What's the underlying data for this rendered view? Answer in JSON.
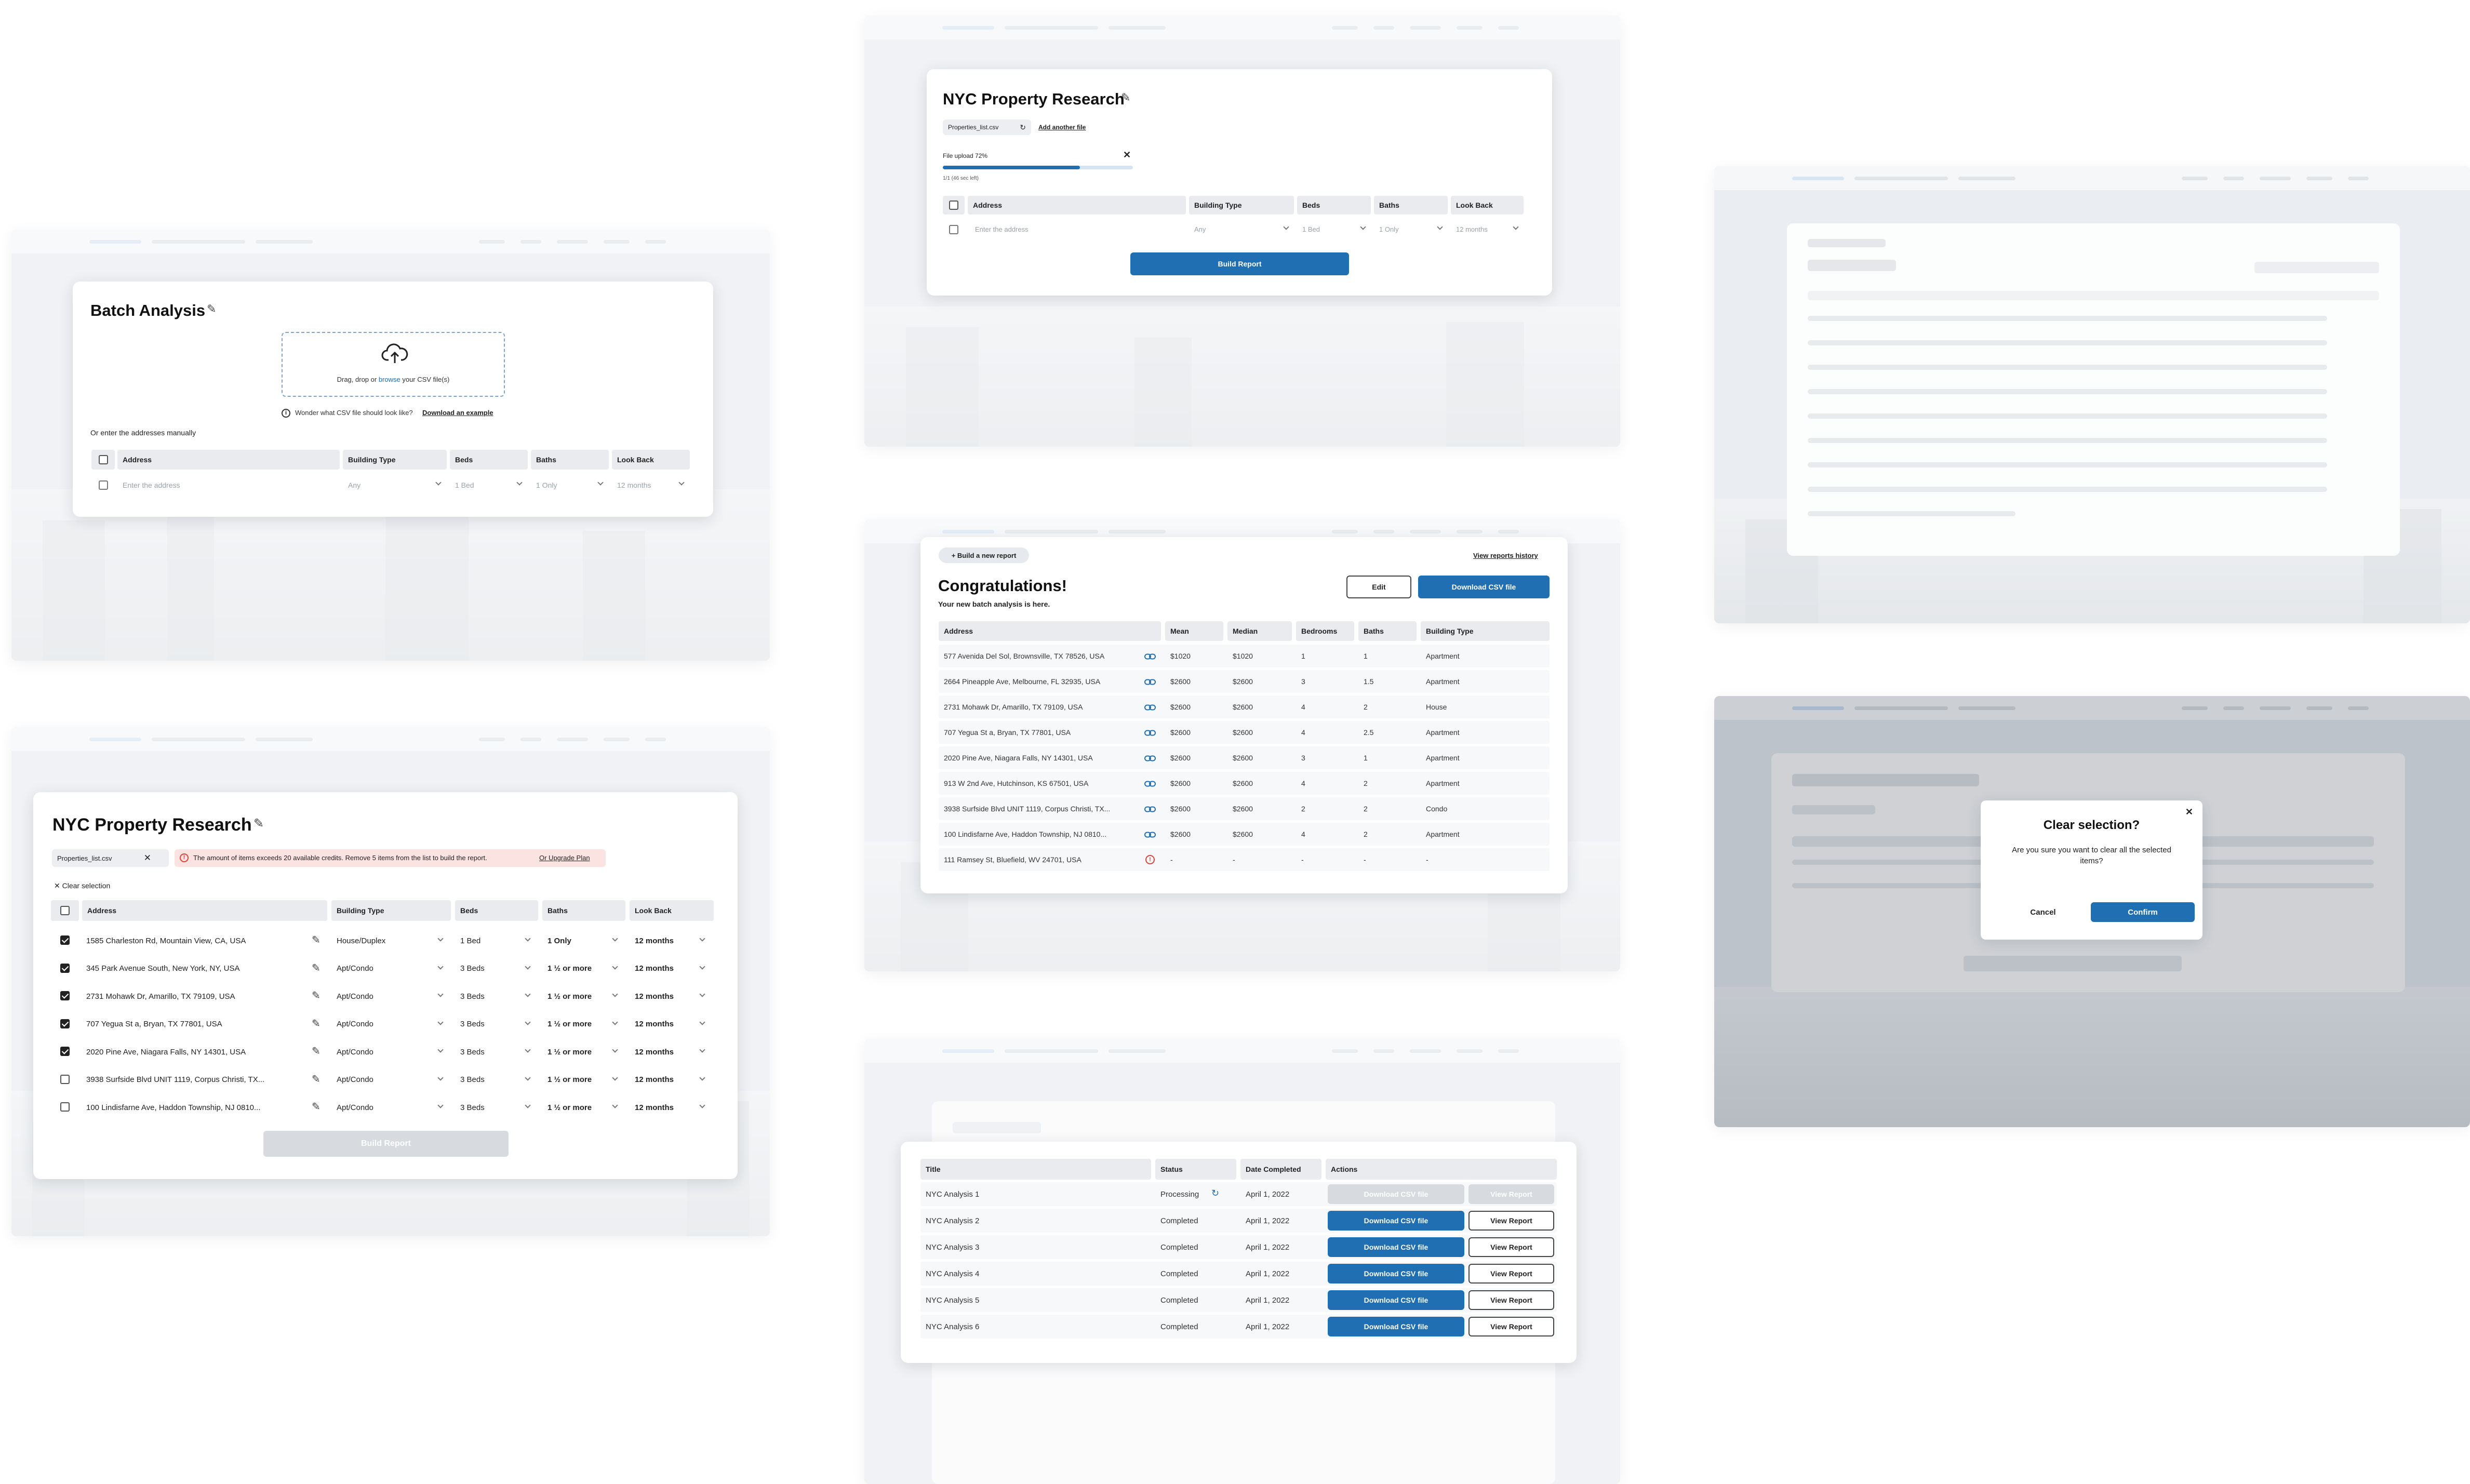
{
  "colors": {
    "accent": "#1f6fb2",
    "error": "#d9463a",
    "warning_bg": "#fbe3e1",
    "disabled": "#d7dade"
  },
  "batch": {
    "title": "Batch Analysis",
    "drop_text": "Drag, drop or browse your CSV file(s)",
    "drop_prefix": "Drag, drop or ",
    "drop_link": "browse",
    "drop_suffix": " your CSV file(s)",
    "hint": "Wonder what CSV file should look like?",
    "hint_link": "Download an example",
    "manual_label": "Or enter the addresses manually",
    "columns": [
      "Address",
      "Building Type",
      "Beds",
      "Baths",
      "Look Back"
    ],
    "row": {
      "address_placeholder": "Enter the address",
      "building": "Any",
      "beds": "1 Bed",
      "baths": "1 Only",
      "lookback": "12 months"
    }
  },
  "upload": {
    "title": "NYC Property Research",
    "file_chip": "Properties_list.csv",
    "add_file": "Add another file",
    "progress_label": "File upload 72%",
    "progress_value": 72,
    "progress_sub": "1/1 (46 sec left)",
    "columns": [
      "Address",
      "Building Type",
      "Beds",
      "Baths",
      "Look Back"
    ],
    "row": {
      "address_placeholder": "Enter the address",
      "building": "Any",
      "beds": "1 Bed",
      "baths": "1 Only",
      "lookback": "12 months"
    },
    "build_button": "Build Report"
  },
  "research": {
    "title": "NYC Property Research",
    "file_chip": "Properties_list.csv",
    "warning": "The amount of items exceeds 20 available credits. Remove 5 items from the list to build the report.",
    "warning_link": "Or Upgrade Plan",
    "clear_selection": "Clear selection",
    "columns": [
      "Address",
      "Building Type",
      "Beds",
      "Baths",
      "Look Back"
    ],
    "rows": [
      {
        "checked": true,
        "address": "1585 Charleston Rd, Mountain View, CA, USA",
        "building": "House/Duplex",
        "beds": "1 Bed",
        "baths": "1 Only",
        "lookback": "12 months"
      },
      {
        "checked": true,
        "address": "345 Park Avenue South, New York, NY, USA",
        "building": "Apt/Condo",
        "beds": "3 Beds",
        "baths": "1 ½ or more",
        "lookback": "12 months"
      },
      {
        "checked": true,
        "address": "2731 Mohawk Dr, Amarillo, TX 79109, USA",
        "building": "Apt/Condo",
        "beds": "3 Beds",
        "baths": "1 ½ or more",
        "lookback": "12 months"
      },
      {
        "checked": true,
        "address": "707 Yegua St a, Bryan, TX 77801, USA",
        "building": "Apt/Condo",
        "beds": "3 Beds",
        "baths": "1 ½ or more",
        "lookback": "12 months"
      },
      {
        "checked": true,
        "address": "2020 Pine Ave, Niagara Falls, NY 14301, USA",
        "building": "Apt/Condo",
        "beds": "3 Beds",
        "baths": "1 ½ or more",
        "lookback": "12 months"
      },
      {
        "checked": false,
        "address": "3938 Surfside Blvd UNIT 1119, Corpus Christi, TX...",
        "building": "Apt/Condo",
        "beds": "3 Beds",
        "baths": "1 ½ or more",
        "lookback": "12 months"
      },
      {
        "checked": false,
        "address": "100 Lindisfarne Ave, Haddon Township, NJ 0810...",
        "building": "Apt/Condo",
        "beds": "3 Beds",
        "baths": "1 ½ or more",
        "lookback": "12 months"
      }
    ],
    "build_button": "Build Report"
  },
  "congrats": {
    "new_report": "+ Build a new report",
    "history_link": "View reports history",
    "title": "Congratulations!",
    "subtitle": "Your new batch analysis is here.",
    "edit_button": "Edit",
    "download_button": "Download CSV file",
    "columns": [
      "Address",
      "Mean",
      "Median",
      "Bedrooms",
      "Baths",
      "Building Type"
    ],
    "rows": [
      {
        "address": "577 Avenida Del Sol, Brownsville, TX 78526, USA",
        "status": "link",
        "mean": "$1020",
        "median": "$1020",
        "bedrooms": "1",
        "baths": "1",
        "building": "Apartment"
      },
      {
        "address": "2664 Pineapple Ave, Melbourne, FL 32935, USA",
        "status": "link",
        "mean": "$2600",
        "median": "$2600",
        "bedrooms": "3",
        "baths": "1.5",
        "building": "Apartment"
      },
      {
        "address": "2731 Mohawk Dr, Amarillo, TX 79109, USA",
        "status": "link",
        "mean": "$2600",
        "median": "$2600",
        "bedrooms": "4",
        "baths": "2",
        "building": "House"
      },
      {
        "address": "707 Yegua St a, Bryan, TX 77801, USA",
        "status": "link",
        "mean": "$2600",
        "median": "$2600",
        "bedrooms": "4",
        "baths": "2.5",
        "building": "Apartment"
      },
      {
        "address": "2020 Pine Ave, Niagara Falls, NY 14301, USA",
        "status": "link",
        "mean": "$2600",
        "median": "$2600",
        "bedrooms": "3",
        "baths": "1",
        "building": "Apartment"
      },
      {
        "address": "913 W 2nd Ave, Hutchinson, KS 67501, USA",
        "status": "link",
        "mean": "$2600",
        "median": "$2600",
        "bedrooms": "4",
        "baths": "2",
        "building": "Apartment"
      },
      {
        "address": "3938 Surfside Blvd UNIT 1119, Corpus Christi, TX...",
        "status": "link",
        "mean": "$2600",
        "median": "$2600",
        "bedrooms": "2",
        "baths": "2",
        "building": "Condo"
      },
      {
        "address": "100 Lindisfarne Ave, Haddon Township, NJ 0810...",
        "status": "link",
        "mean": "$2600",
        "median": "$2600",
        "bedrooms": "4",
        "baths": "2",
        "building": "Apartment"
      },
      {
        "address": "111 Ramsey St, Bluefield, WV 24701, USA",
        "status": "error",
        "mean": "-",
        "median": "-",
        "bedrooms": "-",
        "baths": "-",
        "building": "-"
      }
    ]
  },
  "history": {
    "columns": [
      "Title",
      "Status",
      "Date Completed",
      "Actions"
    ],
    "rows": [
      {
        "title": "NYC Analysis 1",
        "status": "Processing",
        "date": "April 1, 2022",
        "download": "Download CSV file",
        "view": "View Report",
        "disabled": true
      },
      {
        "title": "NYC Analysis 2",
        "status": "Completed",
        "date": "April 1, 2022",
        "download": "Download CSV file",
        "view": "View Report",
        "disabled": false
      },
      {
        "title": "NYC Analysis 3",
        "status": "Completed",
        "date": "April 1, 2022",
        "download": "Download CSV file",
        "view": "View Report",
        "disabled": false
      },
      {
        "title": "NYC Analysis 4",
        "status": "Completed",
        "date": "April 1, 2022",
        "download": "Download CSV file",
        "view": "View Report",
        "disabled": false
      },
      {
        "title": "NYC Analysis 5",
        "status": "Completed",
        "date": "April 1, 2022",
        "download": "Download CSV file",
        "view": "View Report",
        "disabled": false
      },
      {
        "title": "NYC Analysis 6",
        "status": "Completed",
        "date": "April 1, 2022",
        "download": "Download CSV file",
        "view": "View Report",
        "disabled": false
      }
    ]
  },
  "dialog": {
    "title": "Clear selection?",
    "message": "Are you sure you want to clear all the selected items?",
    "cancel": "Cancel",
    "confirm": "Confirm"
  }
}
